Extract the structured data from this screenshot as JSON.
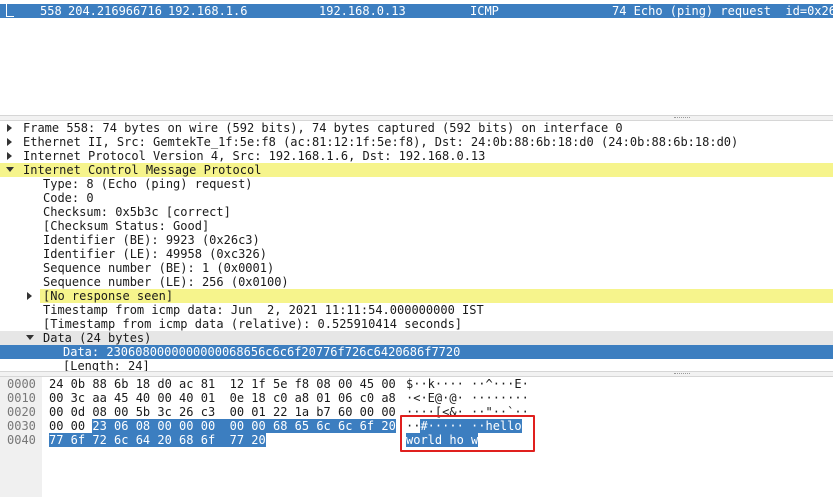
{
  "packet_list": {
    "row": {
      "no": "558",
      "time": "204.216966716",
      "source": "192.168.1.6",
      "destination": "192.168.0.13",
      "protocol": "ICMP",
      "info": "74 Echo (ping) request  id=0x26"
    }
  },
  "details": {
    "frame": "Frame 558: 74 bytes on wire (592 bits), 74 bytes captured (592 bits) on interface 0",
    "ethernet": "Ethernet II, Src: GemtekTe_1f:5e:f8 (ac:81:12:1f:5e:f8), Dst: 24:0b:88:6b:18:d0 (24:0b:88:6b:18:d0)",
    "ip": "Internet Protocol Version 4, Src: 192.168.1.6, Dst: 192.168.0.13",
    "icmp": "Internet Control Message Protocol",
    "type": "Type: 8 (Echo (ping) request)",
    "code": "Code: 0",
    "checksum": "Checksum: 0x5b3c [correct]",
    "checksum_status": "[Checksum Status: Good]",
    "id_be": "Identifier (BE): 9923 (0x26c3)",
    "id_le": "Identifier (LE): 49958 (0xc326)",
    "seq_be": "Sequence number (BE): 1 (0x0001)",
    "seq_le": "Sequence number (LE): 256 (0x0100)",
    "no_response": "[No response seen]",
    "timestamp": "Timestamp from icmp data: Jun  2, 2021 11:11:54.000000000 IST",
    "timestamp_rel": "[Timestamp from icmp data (relative): 0.525910414 seconds]",
    "data": "Data (24 bytes)",
    "data_value": "Data: 2306080000000000068656c6c6f20776f726c6420686f7720",
    "length": "[Length: 24]"
  },
  "bytes": {
    "rows": [
      {
        "offset": "0000",
        "hex": "24 0b 88 6b 18 d0 ac 81  12 1f 5e f8 08 00 45 00",
        "ascii": "$··k···· ··^···E·"
      },
      {
        "offset": "0010",
        "hex": "00 3c aa 45 40 00 40 01  0e 18 c0 a8 01 06 c0 a8",
        "ascii": "·<·E@·@· ········"
      },
      {
        "offset": "0020",
        "hex": "00 0d 08 00 5b 3c 26 c3  00 01 22 1a b7 60 00 00",
        "ascii": "····[<&· ··\"··`··"
      },
      {
        "offset": "0030",
        "hex_plain": "00 00 ",
        "hex_sel": "23 06 08 00 00 00  00 00 68 65 6c 6c 6f 20",
        "ascii_plain": "··",
        "ascii_sel": "#····· ··hello"
      },
      {
        "offset": "0040",
        "hex_sel": "77 6f 72 6c 64 20 68 6f  77 20",
        "ascii_sel": "world ho w"
      }
    ]
  }
}
